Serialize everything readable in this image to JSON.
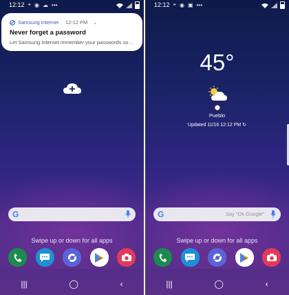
{
  "status": {
    "time": "12:12",
    "left_extra": "•••",
    "right_extra": "•••"
  },
  "notification": {
    "app_name": "Samsung Internet",
    "time": "12:12 PM",
    "title": "Never forget a password",
    "message": "Let Samsung Internet remember your passwords so .."
  },
  "search": {
    "placeholder_right": "Say \"Ok Google\""
  },
  "home": {
    "swipe_hint": "Swipe up or down for all apps"
  },
  "weather": {
    "temperature": "45°",
    "location": "Pueblo",
    "updated": "Updated 11/16 12:12 PM"
  },
  "dock": {
    "apps": [
      {
        "name": "Phone",
        "color": "#1d8a4f"
      },
      {
        "name": "Messages",
        "color": "#1e8fd8"
      },
      {
        "name": "Samsung Internet",
        "color": "#5a63d9"
      },
      {
        "name": "Play Store",
        "color": "#ffffff"
      },
      {
        "name": "Camera",
        "color": "#e23a5a"
      }
    ]
  },
  "navbar": {
    "recents": "|||",
    "home": "◯",
    "back": "‹"
  }
}
